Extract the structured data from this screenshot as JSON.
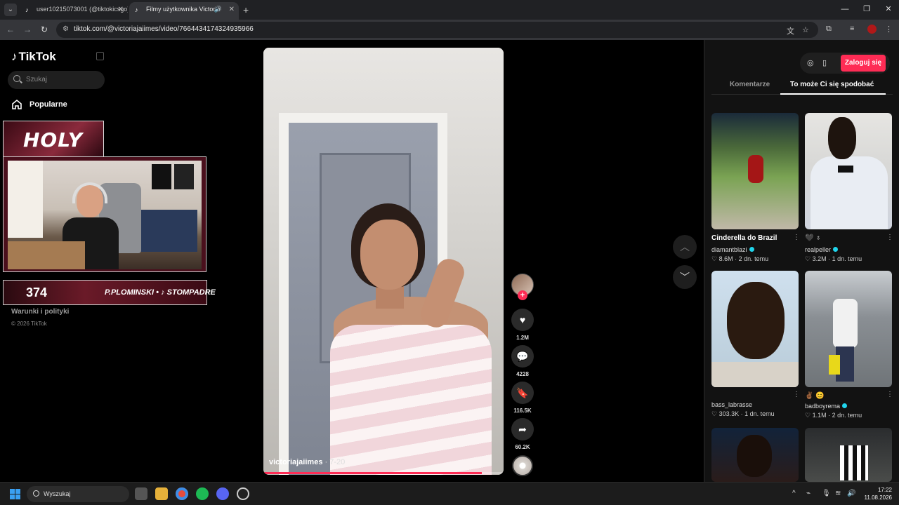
{
  "browser": {
    "tabs": [
      {
        "title": "user10215073001 (@tiktokicsgo)",
        "active": false
      },
      {
        "title": "Filmy użytkownika Victoria",
        "active": true
      }
    ],
    "new_tab": "+",
    "url": "tiktok.com/@victoriajaiimes/video/7664434174324935966"
  },
  "sidebar": {
    "logo": "TikTok",
    "search_placeholder": "Szukaj",
    "nav": [
      {
        "label": "Popularne",
        "icon": "home-icon"
      }
    ],
    "footer_links": "Warunki i polityki",
    "copyright": "© 2026 TikTok"
  },
  "overlay": {
    "banner": "HOLY",
    "counter": "374",
    "handles": "P.PLOMINSKI • ♪ STOMPADRE"
  },
  "video": {
    "author": "victoriajaiimes",
    "date": " · 7-20",
    "progress": 0.91
  },
  "actions": {
    "likes": "1.2M",
    "comments": "4228",
    "saves": "116.5K",
    "shares": "60.2K"
  },
  "right_panel": {
    "login_label": "Zaloguj się",
    "tabs": [
      "Komentarze",
      "To może Ci się spodobać"
    ],
    "active_tab": 1,
    "items": [
      {
        "title": "Cinderella do Brazil",
        "user": "diamantblazi",
        "verified": true,
        "likes": "8.6M",
        "age": "2 dn. temu"
      },
      {
        "title": "🖤 ♁",
        "user": "realpeller",
        "verified": true,
        "likes": "3.2M",
        "age": "1 dn. temu"
      },
      {
        "title": "",
        "user": "bass_labrasse",
        "verified": false,
        "likes": "303.3K",
        "age": "1 dn. temu"
      },
      {
        "title": "✌🏾 😊",
        "user": "badboyrema",
        "verified": true,
        "likes": "1.1M",
        "age": "2 dn. temu"
      }
    ]
  },
  "taskbar": {
    "search_label": "Wyszukaj",
    "time": "17:22",
    "date": "11.08.2026"
  },
  "colors": {
    "accent": "#fe2c55",
    "verified": "#20d5ec",
    "background": "#000000"
  }
}
